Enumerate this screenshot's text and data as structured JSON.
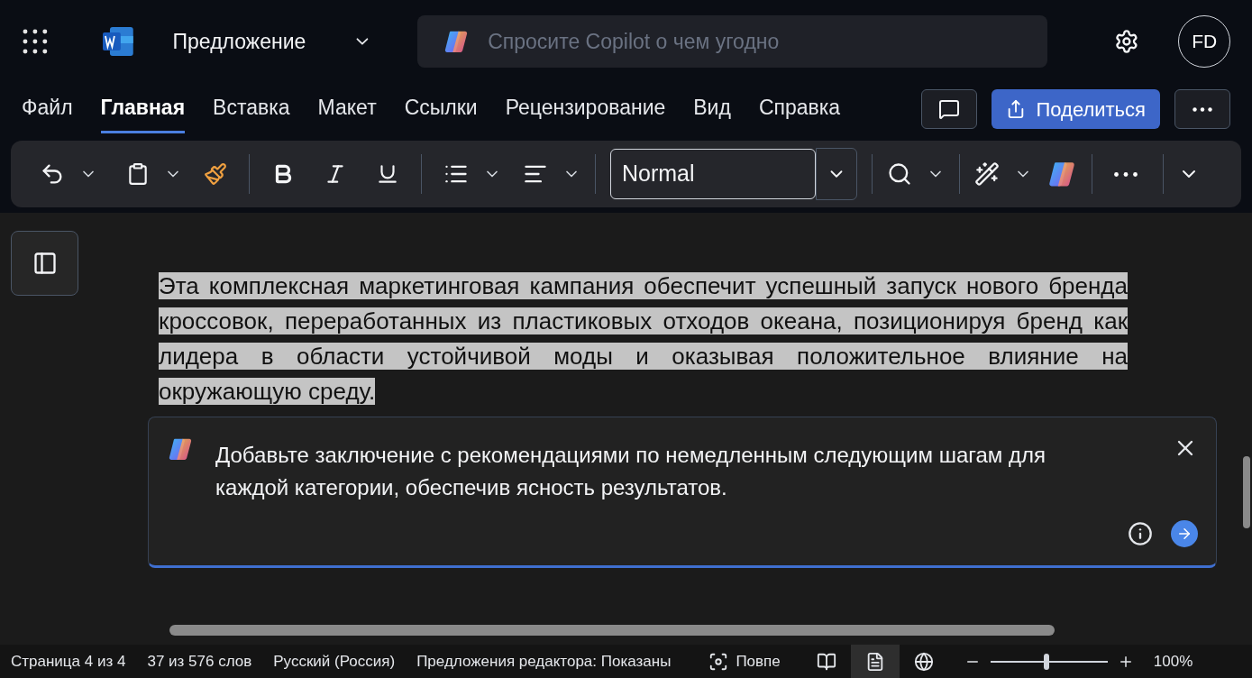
{
  "app_bar": {
    "document_title": "Предложение",
    "search": {
      "placeholder": "Спросите Copilot о чем угодно"
    },
    "avatar": "FD"
  },
  "tabs": [
    {
      "label": "Файл",
      "selected": false
    },
    {
      "label": "Главная",
      "selected": true
    },
    {
      "label": "Вставка",
      "selected": false
    },
    {
      "label": "Макет",
      "selected": false
    },
    {
      "label": "Ссылки",
      "selected": false
    },
    {
      "label": "Рецензирование",
      "selected": false
    },
    {
      "label": "Вид",
      "selected": false
    },
    {
      "label": "Справка",
      "selected": false
    }
  ],
  "share_button": "Поделиться",
  "toolbar": {
    "style": "Normal"
  },
  "document": {
    "paragraph": "Эта комплексная маркетинговая кампания обеспечит успешный запуск нового бренда кроссовок, переработанных из пластиковых отходов океана, позиционируя бренд как лидера в области устойчивой моды и оказывая положительное влияние на окружающую среду.",
    "selected": true
  },
  "copilot_prompt": {
    "value": "Добавьте заключение с рекомендациями по немедленным следующим шагам для каждой категории, обеспечив ясность результатов."
  },
  "status_bar": {
    "items": [
      "Страница 4 из 4",
      "37 из 576 слов",
      "Русский (Россия)",
      "Предложения редактора: Показаны"
    ],
    "focus": "Повпе",
    "views": [
      {
        "kind": "read",
        "selected": false
      },
      {
        "kind": "print",
        "selected": true
      },
      {
        "kind": "web",
        "selected": false
      }
    ],
    "zoom": {
      "level": 0.48,
      "reading": "100%"
    }
  }
}
